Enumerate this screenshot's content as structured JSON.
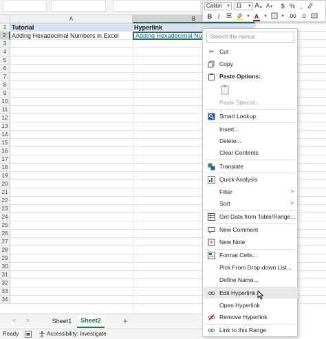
{
  "columns": [
    "A",
    "B"
  ],
  "rows": [
    "1",
    "2",
    "3",
    "4",
    "5",
    "6",
    "7",
    "8",
    "9",
    "10",
    "11",
    "12",
    "13",
    "14",
    "15",
    "16",
    "17",
    "18",
    "19",
    "20",
    "21",
    "22",
    "23",
    "24",
    "25",
    "26",
    "27",
    "28",
    "29",
    "30",
    "31",
    "32",
    "33",
    "34"
  ],
  "cells": {
    "a1": "Tutorial",
    "b1": "Hyperlink",
    "a2": "Adding Hexadecimal Numbers in Excel",
    "b2": "Adding Hexadecimal Num"
  },
  "mini_toolbar": {
    "font_name": "Calibri",
    "font_size": "11",
    "bold": "B",
    "italic": "I",
    "font_color_letter": "A",
    "percent": "%",
    "comma": ","
  },
  "menu": {
    "search_placeholder": "Search the menus",
    "items": {
      "cut": "Cut",
      "copy": "Copy",
      "paste_options": "Paste Options:",
      "paste_special": "Paste Special...",
      "smart_lookup": "Smart Lookup",
      "insert": "Insert...",
      "delete": "Delete...",
      "clear_contents": "Clear Contents",
      "translate": "Translate",
      "quick_analysis": "Quick Analysis",
      "filter": "Filter",
      "sort": "Sort",
      "get_data": "Get Data from Table/Range...",
      "new_comment": "New Comment",
      "new_note": "New Note",
      "format_cells": "Format Cells...",
      "pick_dropdown": "Pick From Drop-down List...",
      "define_name": "Define Name...",
      "edit_hyperlink": "Edit Hyperlink...",
      "open_hyperlink": "Open Hyperlink",
      "remove_hyperlink": "Remove Hyperlink",
      "link_range": "Link to this Range"
    },
    "icons": {
      "cut": "scissors-icon",
      "copy": "copy-icon",
      "paste_options": "paste-icon",
      "paste_option_button": "clipboard-icon",
      "smart_lookup": "search-icon",
      "translate": "translate-icon",
      "quick_analysis": "quick-analysis-icon",
      "get_data": "table-icon",
      "new_comment": "comment-icon",
      "new_note": "note-icon",
      "format_cells": "format-cells-icon",
      "edit_hyperlink": "link-icon",
      "remove_hyperlink": "unlink-icon",
      "link_range": "link-icon"
    }
  },
  "sheets": [
    "Sheet1",
    "Sheet2"
  ],
  "active_sheet": "Sheet2",
  "add_sheet": "+",
  "status": {
    "ready": "Ready",
    "accessibility": "Accessibility: Investigate"
  },
  "colors": {
    "accent": "#217346",
    "header_fill": "#d9e1f2",
    "link": "#0563c1",
    "font_color_bar": "#c00000"
  }
}
